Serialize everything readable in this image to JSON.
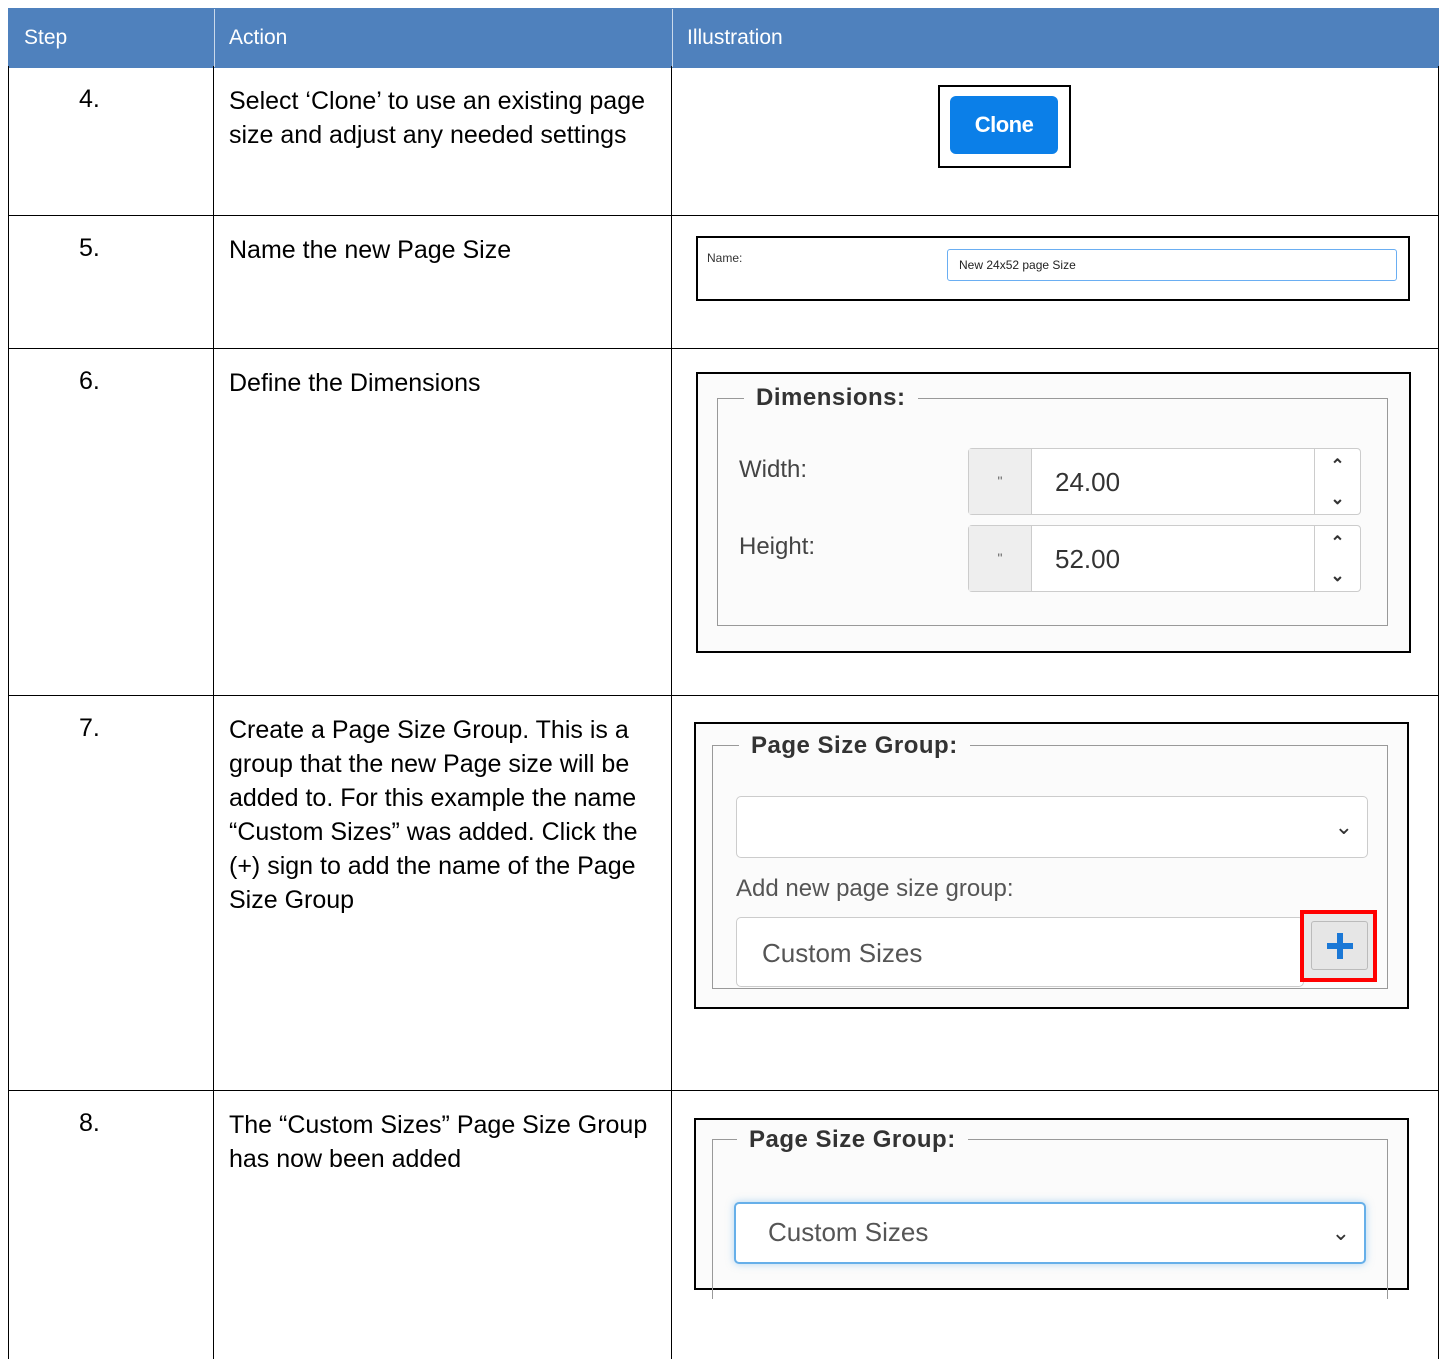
{
  "table": {
    "headers": {
      "step": "Step",
      "action": "Action",
      "illustration": "Illustration"
    },
    "rows": [
      {
        "step": "4.",
        "action": "Select ‘Clone’ to use an existing page size and adjust any needed settings",
        "illustration": {
          "button_label": "Clone",
          "button_color": "#0b7fe8"
        }
      },
      {
        "step": "5.",
        "action": "Name the new Page Size",
        "illustration": {
          "label": "Name:",
          "value": "New 24x52 page Size"
        }
      },
      {
        "step": "6.",
        "action": "Define the Dimensions",
        "illustration": {
          "legend": "Dimensions:",
          "width_label": "Width:",
          "width_unit": "\"",
          "width_value": "24.00",
          "height_label": "Height:",
          "height_unit": "\"",
          "height_value": "52.00"
        }
      },
      {
        "step": "7.",
        "action": "Create a Page Size Group. This is a group that the new Page size will be added to. For this example the name “Custom Sizes” was added. Click the (+) sign to add the name of the Page Size Group",
        "illustration": {
          "legend": "Page Size Group:",
          "select_value": "",
          "add_label": "Add new page size group:",
          "input_value": "Custom Sizes",
          "highlight_color": "#ff0000"
        }
      },
      {
        "step": "8.",
        "action": "The “Custom Sizes” Page Size Group has now been added",
        "illustration": {
          "legend": "Page Size Group:",
          "select_value": "Custom Sizes"
        }
      }
    ]
  },
  "colors": {
    "header_bg": "#4f81bd",
    "header_text": "#ffffff"
  },
  "icons": {
    "chevron": "chevron-down-icon",
    "spinner_up": "chevron-up-icon",
    "plus": "plus-icon"
  }
}
